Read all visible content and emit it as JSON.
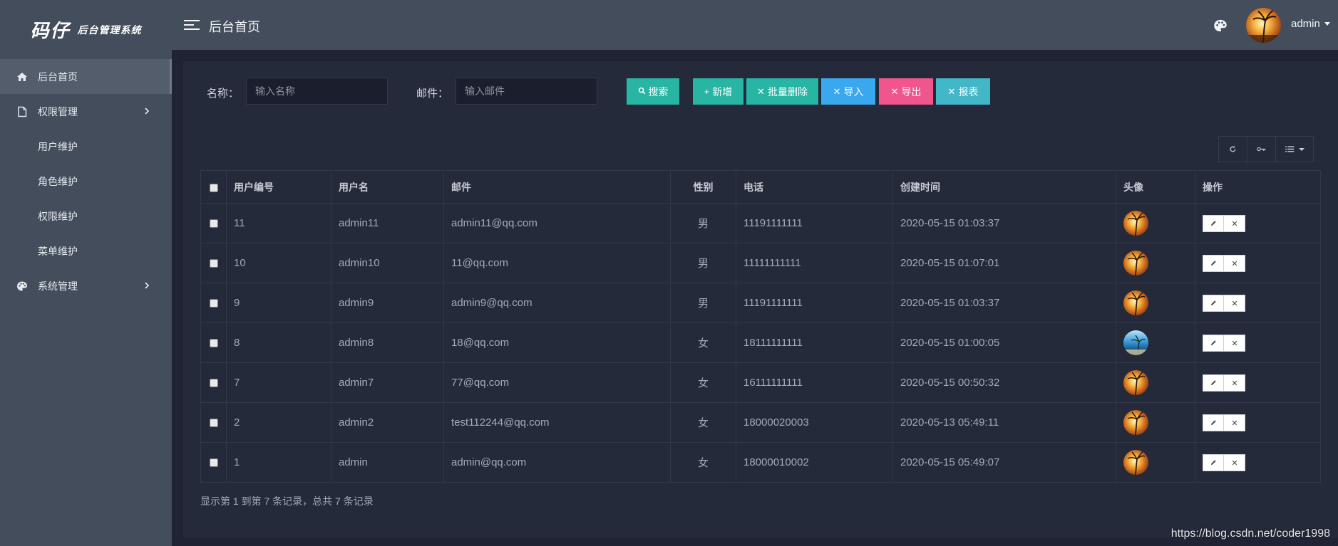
{
  "sidebar": {
    "logo_main": "码仔",
    "logo_sub": "后台管理系统",
    "items": [
      {
        "label": "后台首页",
        "icon": "home-icon",
        "active": true
      },
      {
        "label": "权限管理",
        "icon": "file-icon",
        "expanded": true,
        "children": [
          {
            "label": "用户维护"
          },
          {
            "label": "角色维护"
          },
          {
            "label": "权限维护"
          },
          {
            "label": "菜单维护"
          }
        ]
      },
      {
        "label": "系统管理",
        "icon": "palette-icon"
      }
    ]
  },
  "header": {
    "title": "后台首页",
    "user": "admin"
  },
  "filters": {
    "name_label": "名称：",
    "name_placeholder": "输入名称",
    "email_label": "邮件：",
    "email_placeholder": "输入邮件"
  },
  "actions": {
    "search": "搜索",
    "add": "新增",
    "batch_delete": "批量删除",
    "import": "导入",
    "export": "导出",
    "report": "报表"
  },
  "table": {
    "headers": [
      "用户编号",
      "用户名",
      "邮件",
      "性别",
      "电话",
      "创建时间",
      "头像",
      "操作"
    ],
    "rows": [
      {
        "id": "11",
        "username": "admin11",
        "email": "admin11@qq.com",
        "gender": "男",
        "phone": "11191111111",
        "created": "2020-05-15 01:03:37",
        "avatar": "sunset"
      },
      {
        "id": "10",
        "username": "admin10",
        "email": "11@qq.com",
        "gender": "男",
        "phone": "11111111111",
        "created": "2020-05-15 01:07:01",
        "avatar": "sunset"
      },
      {
        "id": "9",
        "username": "admin9",
        "email": "admin9@qq.com",
        "gender": "男",
        "phone": "11191111111",
        "created": "2020-05-15 01:03:37",
        "avatar": "sunset"
      },
      {
        "id": "8",
        "username": "admin8",
        "email": "18@qq.com",
        "gender": "女",
        "phone": "18111111111",
        "created": "2020-05-15 01:00:05",
        "avatar": "beach"
      },
      {
        "id": "7",
        "username": "admin7",
        "email": "77@qq.com",
        "gender": "女",
        "phone": "16111111111",
        "created": "2020-05-15 00:50:32",
        "avatar": "sunset"
      },
      {
        "id": "2",
        "username": "admin2",
        "email": "test112244@qq.com",
        "gender": "女",
        "phone": "18000020003",
        "created": "2020-05-13 05:49:11",
        "avatar": "sunset"
      },
      {
        "id": "1",
        "username": "admin",
        "email": "admin@qq.com",
        "gender": "女",
        "phone": "18000010002",
        "created": "2020-05-15 05:49:07",
        "avatar": "sunset"
      }
    ]
  },
  "pager": {
    "summary": "显示第 1 到第 7 条记录，总共 7 条记录"
  },
  "watermark": "https://blog.csdn.net/coder1998",
  "colors": {
    "accent_teal": "#28b5a4",
    "accent_blue": "#3aa8ee",
    "accent_pink": "#f0558b",
    "accent_cyan": "#42b7c8",
    "sidebar_bg": "#434d5c",
    "content_bg": "#252a3b"
  }
}
